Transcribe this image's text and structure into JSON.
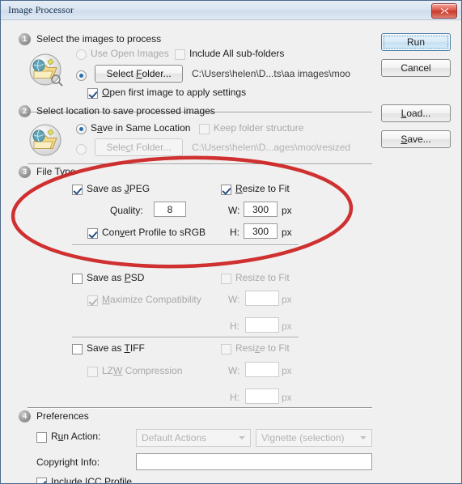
{
  "window": {
    "title": "Image Processor",
    "close_label": "close-window"
  },
  "buttons": {
    "run": "Run",
    "cancel": "Cancel",
    "load": "Load...",
    "save": "Save..."
  },
  "step1": {
    "number": "1",
    "title": "Select the images to process",
    "use_open_images": "Use Open Images",
    "include_subfolders": "Include All sub-folders",
    "select_folder": "Select Folder...",
    "path": "C:\\Users\\helen\\D...ts\\aa images\\moo",
    "open_first_image": "Open first image to apply settings"
  },
  "step2": {
    "number": "2",
    "title": "Select location to save processed images",
    "save_same_location": "Save in Same Location",
    "keep_folder_structure": "Keep folder structure",
    "select_folder": "Select Folder...",
    "path": "C:\\Users\\helen\\D...ages\\moo\\resized"
  },
  "step3": {
    "number": "3",
    "title": "File Type",
    "jpeg": {
      "save_as": "Save as JPEG",
      "resize_to_fit": "Resize to Fit",
      "quality_label": "Quality:",
      "quality_value": "8",
      "w_label": "W:",
      "w_value": "300",
      "h_label": "H:",
      "h_value": "300",
      "px": "px",
      "convert_srgb": "Convert Profile to sRGB"
    },
    "psd": {
      "save_as": "Save as PSD",
      "resize_to_fit": "Resize to Fit",
      "maximize_compatibility": "Maximize Compatibility",
      "w_label": "W:",
      "w_value": "",
      "h_label": "H:",
      "h_value": "",
      "px": "px"
    },
    "tiff": {
      "save_as": "Save as TIFF",
      "resize_to_fit": "Resize to Fit",
      "lzw_compression": "LZW Compression",
      "w_label": "W:",
      "w_value": "",
      "h_label": "H:",
      "h_value": "",
      "px": "px"
    }
  },
  "step4": {
    "number": "4",
    "title": "Preferences",
    "run_action_label": "Run Action:",
    "action_set": "Default Actions",
    "action_name": "Vignette (selection)",
    "copyright_label": "Copyright Info:",
    "copyright_value": "",
    "include_icc": "Include ICC Profile"
  },
  "annotation": {
    "shape": "ellipse",
    "color": "#cc1f1f"
  }
}
